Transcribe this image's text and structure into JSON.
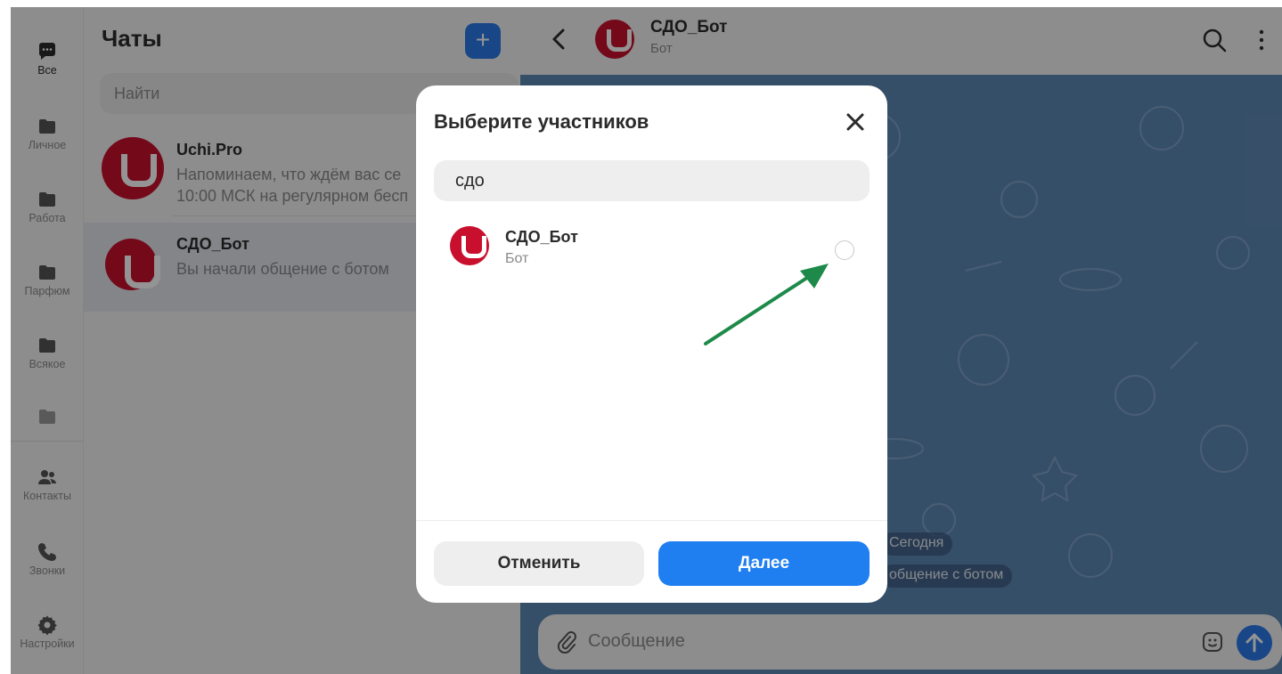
{
  "rail": {
    "items": [
      {
        "label": "Все",
        "icon": "chat-bubble-icon"
      },
      {
        "label": "Личное",
        "icon": "folder-icon"
      },
      {
        "label": "Работа",
        "icon": "folder-icon"
      },
      {
        "label": "Парфюм",
        "icon": "folder-icon"
      },
      {
        "label": "Всякое",
        "icon": "folder-icon"
      },
      {
        "label": "",
        "icon": "folder-icon"
      },
      {
        "label": "Контакты",
        "icon": "contacts-icon"
      },
      {
        "label": "Звонки",
        "icon": "phone-icon"
      },
      {
        "label": "Настройки",
        "icon": "gear-icon"
      }
    ]
  },
  "chat_list": {
    "title": "Чаты",
    "new_button": "+",
    "search_placeholder": "Найти",
    "chats": [
      {
        "name": "Uchi.Pro",
        "line1": "Напоминаем, что ждём вас се",
        "line2": "10:00 МСК на регулярном бесп"
      },
      {
        "name": "СДО_Бот",
        "line1": "Вы начали общение с ботом"
      }
    ]
  },
  "chat_pane": {
    "title": "СДО_Бот",
    "subtitle": "Бот",
    "date_pill": "Сегодня",
    "system_message": "общение с ботом",
    "composer_placeholder": "Сообщение"
  },
  "modal": {
    "title": "Выберите участников",
    "search_value": "сдо",
    "results": [
      {
        "name": "СДО_Бот",
        "subtitle": "Бот",
        "selected": false
      }
    ],
    "cancel_label": "Отменить",
    "next_label": "Далее"
  },
  "colors": {
    "accent": "#1f7ef0",
    "brand_red": "#c8102e",
    "annotation_arrow": "#1e8a4a",
    "chat_background": "#5e88b5"
  }
}
